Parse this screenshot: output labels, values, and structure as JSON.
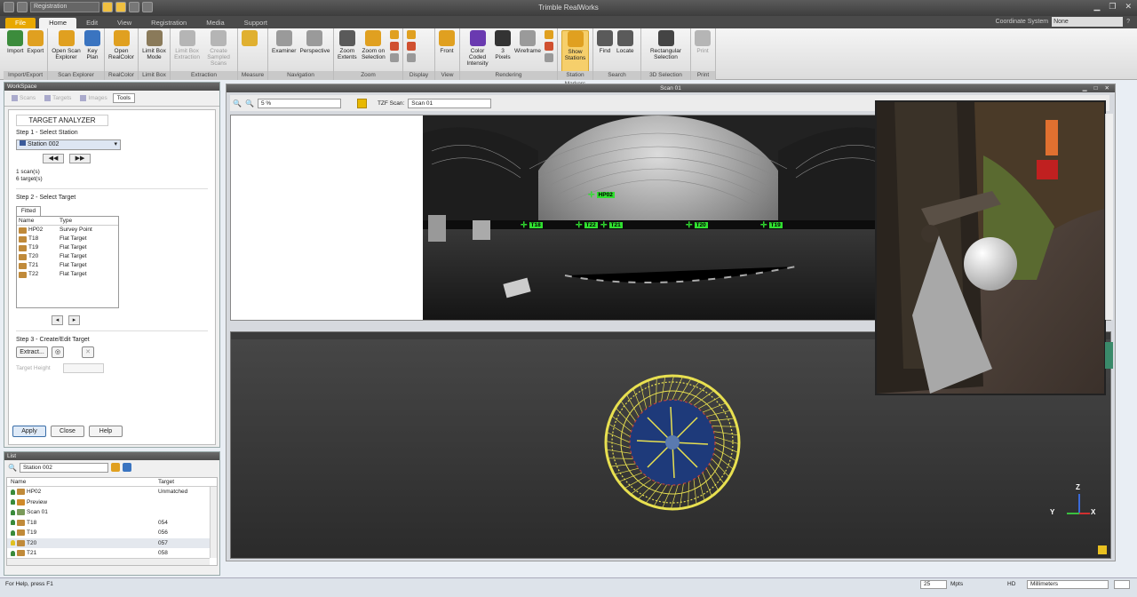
{
  "window": {
    "title": "Trimble RealWorks",
    "qat_combo": "Registration"
  },
  "tabs": [
    {
      "label": "File",
      "state": "file"
    },
    {
      "label": "Home",
      "state": "active"
    },
    {
      "label": "Edit",
      "state": ""
    },
    {
      "label": "View",
      "state": ""
    },
    {
      "label": "Registration",
      "state": ""
    },
    {
      "label": "Media",
      "state": ""
    },
    {
      "label": "Support",
      "state": ""
    }
  ],
  "coordinate_system": {
    "label": "Coordinate System",
    "value": "None"
  },
  "ribbon": {
    "groups": [
      {
        "label": "Import/Export",
        "buttons": [
          {
            "label": "Import",
            "icon": "import-icon",
            "color": "#3c8c3c"
          },
          {
            "label": "Export",
            "icon": "export-icon",
            "color": "#e0a020"
          }
        ]
      },
      {
        "label": "Scan Explorer",
        "buttons": [
          {
            "label": "Open Scan Explorer",
            "icon": "scan-explorer-icon",
            "color": "#e0a020"
          },
          {
            "label": "Key Plan",
            "icon": "key-plan-icon",
            "color": "#3a74c0"
          }
        ]
      },
      {
        "label": "RealColor",
        "buttons": [
          {
            "label": "Open RealColor",
            "icon": "realcolor-icon",
            "color": "#e0a020"
          }
        ]
      },
      {
        "label": "Limit Box",
        "buttons": [
          {
            "label": "Limit Box Mode",
            "icon": "limit-box-icon",
            "color": "#8a7a5a"
          }
        ]
      },
      {
        "label": "Extraction",
        "buttons": [
          {
            "label": "Limit Box Extraction",
            "icon": "limit-box-extraction-icon",
            "color": "#b5b5b5",
            "disabled": true
          },
          {
            "label": "Create Sampled Scans",
            "icon": "sampled-scans-icon",
            "color": "#b5b5b5",
            "disabled": true
          }
        ]
      },
      {
        "label": "Measure",
        "buttons": [
          {
            "label": "",
            "icon": "measure-icon",
            "color": "#e0b030"
          }
        ]
      },
      {
        "label": "Navigation",
        "buttons": [
          {
            "label": "Examiner",
            "icon": "hand-icon",
            "color": "#9a9a9a"
          },
          {
            "label": "Perspective",
            "icon": "perspective-icon",
            "color": "#9a9a9a"
          }
        ]
      },
      {
        "label": "Zoom",
        "buttons": [
          {
            "label": "Zoom Extents",
            "icon": "zoom-extents-icon",
            "color": "#5a5a5a"
          },
          {
            "label": "Zoom on Selection",
            "icon": "zoom-selection-icon",
            "color": "#e0a020"
          }
        ]
      },
      {
        "label": "Display",
        "buttons": []
      },
      {
        "label": "View",
        "buttons": [
          {
            "label": "Front",
            "icon": "front-view-icon",
            "color": "#e0a020"
          }
        ]
      },
      {
        "label": "Rendering",
        "buttons": [
          {
            "label": "Color Coded Intensity",
            "icon": "color-coded-icon",
            "color": "#6a3ab0"
          },
          {
            "label": "3 Pixels",
            "icon": "pixels-icon",
            "color": "#333333"
          },
          {
            "label": "Wireframe",
            "icon": "wireframe-icon",
            "color": "#9a9a9a"
          }
        ]
      },
      {
        "label": "Station Markers",
        "buttons": [
          {
            "label": "Show Stations",
            "icon": "show-stations-icon",
            "color": "#e0a020",
            "highlight": true
          }
        ]
      },
      {
        "label": "Search",
        "buttons": [
          {
            "label": "Find",
            "icon": "find-icon",
            "color": "#5a5a5a"
          },
          {
            "label": "Locate",
            "icon": "locate-icon",
            "color": "#5a5a5a"
          }
        ]
      },
      {
        "label": "3D Selection",
        "buttons": [
          {
            "label": "Rectangular Selection",
            "icon": "rectangular-selection-icon",
            "color": "#444444"
          }
        ]
      },
      {
        "label": "Print",
        "buttons": [
          {
            "label": "Print",
            "icon": "print-icon",
            "color": "#b5b5b5",
            "disabled": true
          }
        ]
      }
    ]
  },
  "workspace": {
    "title": "WorkSpace",
    "tabs": [
      "Scans",
      "Targets",
      "Images",
      "Tools"
    ],
    "analyzer_title": "TARGET ANALYZER",
    "step1": "Step 1 - Select Station",
    "station": "Station 002",
    "prev": "◀◀",
    "next": "▶▶",
    "scan_count": "1 scan(s)",
    "target_count": "6 target(s)",
    "step2": "Step 2 - Select Target",
    "fitted_tab": "Fitted",
    "col_name": "Name",
    "col_type": "Type",
    "targets": [
      {
        "name": "HP02",
        "type": "Survey Point"
      },
      {
        "name": "T18",
        "type": "Flat Target"
      },
      {
        "name": "T19",
        "type": "Flat Target"
      },
      {
        "name": "T20",
        "type": "Flat Target"
      },
      {
        "name": "T21",
        "type": "Flat Target"
      },
      {
        "name": "T22",
        "type": "Flat Target"
      }
    ],
    "step3": "Step 3 - Create/Edit Target",
    "extract": "Extract...",
    "target_height": "Target Height",
    "apply": "Apply",
    "close": "Close",
    "help": "Help"
  },
  "list": {
    "title": "List",
    "station": "Station 002",
    "col_name": "Name",
    "col_target": "Target",
    "rows": [
      {
        "name": "HP02",
        "target": "Unmatched",
        "bulb": "green"
      },
      {
        "name": "Preview",
        "target": "",
        "bulb": "green"
      },
      {
        "name": "Scan 01",
        "target": "",
        "bulb": "green"
      },
      {
        "name": "T18",
        "target": "054",
        "bulb": "green"
      },
      {
        "name": "T19",
        "target": "056",
        "bulb": "green"
      },
      {
        "name": "T20",
        "target": "057",
        "bulb": "yellow"
      },
      {
        "name": "T21",
        "target": "058",
        "bulb": "green"
      }
    ]
  },
  "scan": {
    "title": "Scan 01",
    "zoom": "5 %",
    "tzf_label": "TZF Scan:",
    "tzf_value": "Scan 01",
    "labels": [
      "HP02",
      "T18",
      "T22",
      "T21",
      "T20",
      "T19"
    ]
  },
  "viewport": {
    "axis_y": "Y",
    "axis_z": "Z",
    "axis_x": "X"
  },
  "statusbar": {
    "help": "For Help, press F1",
    "points": "25",
    "points_unit": "Mpts",
    "hd": "HD",
    "units": "Millimeters"
  }
}
